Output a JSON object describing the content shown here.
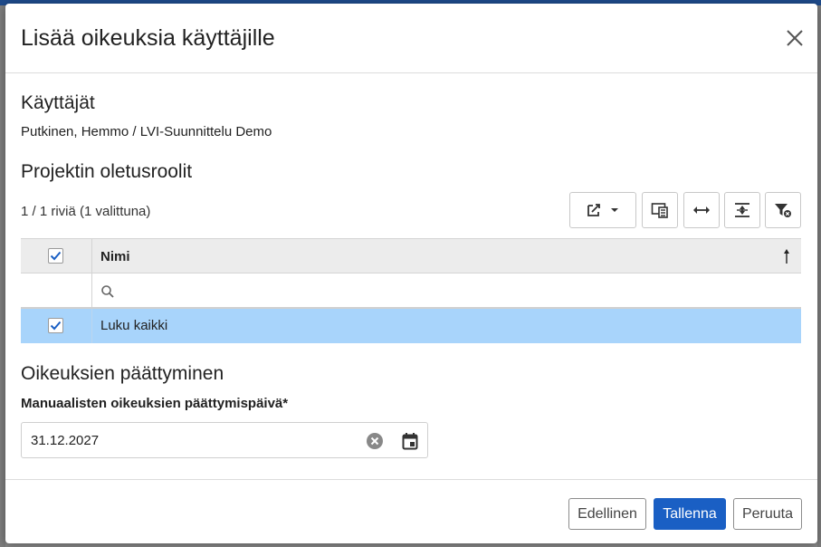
{
  "dialog": {
    "title": "Lisää oikeuksia käyttäjille",
    "close_icon": "close-icon"
  },
  "users": {
    "heading": "Käyttäjät",
    "text": "Putkinen, Hemmo / LVI-Suunnittelu Demo"
  },
  "roles": {
    "heading": "Projektin oletusroolit",
    "row_count": "1 / 1 riviä (1 valittuna)",
    "toolbar": [
      "export-icon",
      "columns-icon",
      "fit-width-icon",
      "row-height-icon",
      "clear-filter-icon"
    ],
    "grid": {
      "column_header": "Nimi",
      "sort_icon": "sort-ascending-icon",
      "filter_icon": "search-icon",
      "rows": [
        {
          "name": "Luku kaikki",
          "selected": true
        }
      ]
    }
  },
  "expiry": {
    "heading": "Oikeuksien päättyminen",
    "field_label": "Manuaalisten oikeuksien päättymispäivä*",
    "value": "31.12.2027",
    "clear_icon": "clear-icon",
    "calendar_icon": "calendar-icon"
  },
  "footer": {
    "previous": "Edellinen",
    "save": "Tallenna",
    "cancel": "Peruuta"
  },
  "colors": {
    "primary": "#1a5fc4",
    "selected_row": "#a8d4fb",
    "header_bg": "#ececec"
  }
}
